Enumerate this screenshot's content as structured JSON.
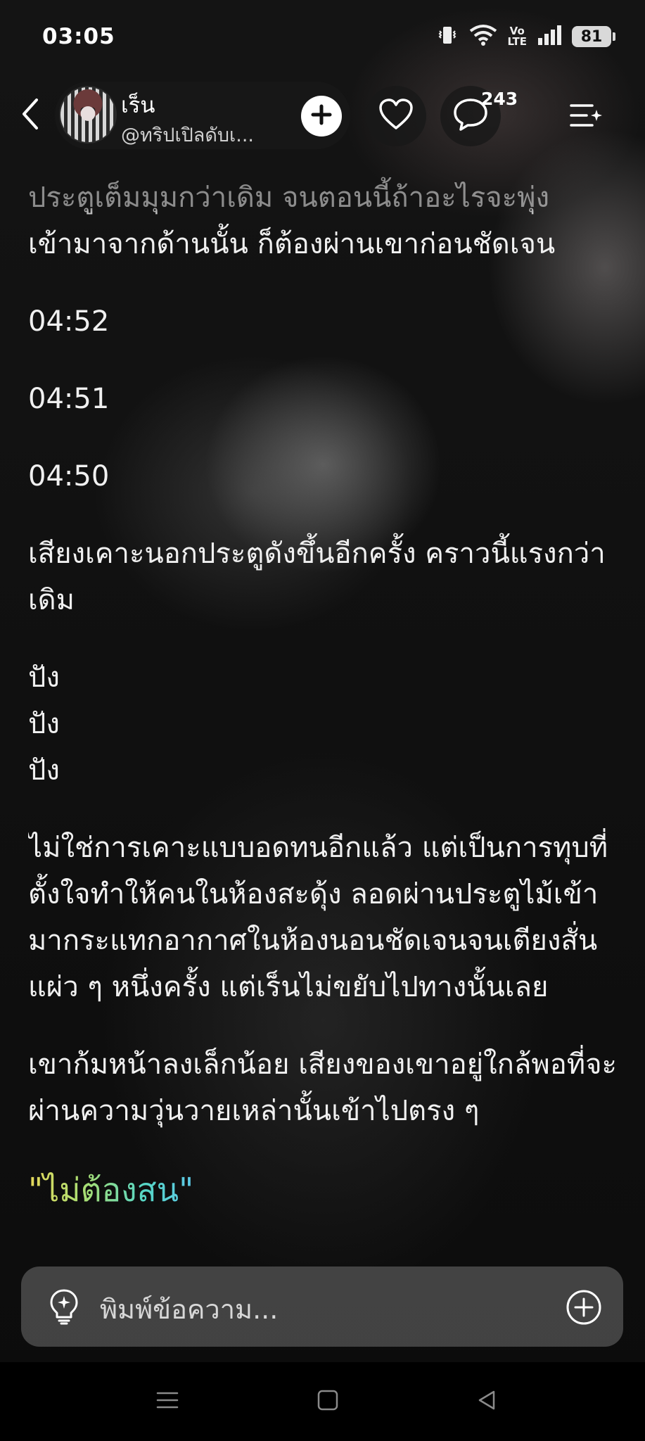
{
  "status_bar": {
    "time": "03:05",
    "volte": "Vo\nLTE",
    "battery": "81"
  },
  "header": {
    "author_name": "เร็น",
    "author_handle": "@ทริปเปิลดับเ...",
    "comment_count": "243"
  },
  "story": {
    "faded_line": "ประตูเต็มมุมกว่าเดิม จนตอนนี้ถ้าอะไรจะพุ่ง",
    "paragraphs": [
      "เข้ามาจากด้านนั้น ก็ต้องผ่านเขาก่อนชัดเจน",
      "04:52",
      "04:51",
      "04:50",
      "เสียงเคาะนอกประตูดังขึ้นอีกครั้ง คราวนี้แรงกว่าเดิม",
      "ไม่ใช่การเคาะแบบอดทนอีกแล้ว แต่เป็นการทุบที่ตั้งใจทำให้คนในห้องสะดุ้ง ลอดผ่านประตูไม้เข้ามากระแทกอากาศในห้องนอนชัดเจนจนเตียงสั่นแผ่ว ๆ หนึ่งครั้ง แต่เร็นไม่ขยับไปทางนั้นเลย",
      "เขาก้มหน้าลงเล็กน้อย เสียงของเขาอยู่ใกล้พอที่จะผ่านความวุ่นวายเหล่านั้นเข้าไปตรง ๆ"
    ],
    "sounds": [
      "ปัง",
      "ปัง",
      "ปัง"
    ],
    "dialogue": "\"ไม่ต้องสน\""
  },
  "input": {
    "placeholder": "พิมพ์ข้อความ..."
  },
  "icons": {
    "back": "chevron-left-icon",
    "add_follow": "plus-icon",
    "like": "heart-icon",
    "comments": "comment-bubble-icon",
    "menu": "menu-sparkle-icon",
    "bulb": "lightbulb-icon",
    "attach": "plus-circle-icon"
  },
  "colors": {
    "background": "#0d0d0d",
    "text": "#f0f0f0",
    "dialogue_gradient_start": "#e6d85a",
    "dialogue_gradient_end": "#5cc8e6"
  }
}
